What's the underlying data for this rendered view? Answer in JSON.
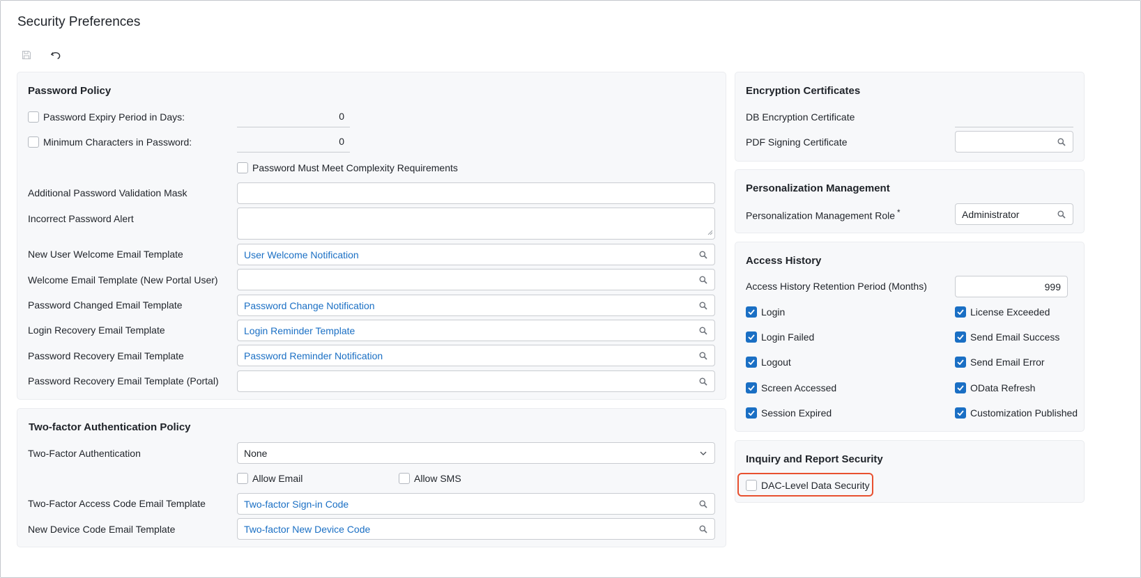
{
  "page": {
    "title": "Security Preferences"
  },
  "toolbar": {
    "save_icon": "save-icon",
    "undo_icon": "undo-icon"
  },
  "password_policy": {
    "title": "Password Policy",
    "expiry": {
      "label": "Password Expiry Period in Days:",
      "value": "0",
      "checked": false
    },
    "min_chars": {
      "label": "Minimum Characters in Password:",
      "value": "0",
      "checked": false
    },
    "complexity": {
      "label": "Password Must Meet Complexity Requirements",
      "checked": false
    },
    "validation_mask": {
      "label": "Additional Password Validation Mask",
      "value": ""
    },
    "incorrect_alert": {
      "label": "Incorrect Password Alert",
      "value": ""
    },
    "welcome_email": {
      "label": "New User Welcome Email Template",
      "value": "User Welcome Notification"
    },
    "portal_welcome_email": {
      "label": "Welcome Email Template (New Portal User)",
      "value": ""
    },
    "changed_email": {
      "label": "Password Changed Email Template",
      "value": "Password Change Notification"
    },
    "login_recovery_email": {
      "label": "Login Recovery Email Template",
      "value": "Login Reminder Template"
    },
    "recovery_email": {
      "label": "Password Recovery Email Template",
      "value": "Password Reminder Notification"
    },
    "recovery_email_portal": {
      "label": "Password Recovery Email Template (Portal)",
      "value": ""
    }
  },
  "two_factor": {
    "title": "Two-factor Authentication Policy",
    "mode": {
      "label": "Two-Factor Authentication",
      "value": "None"
    },
    "allow_email": {
      "label": "Allow Email",
      "checked": false
    },
    "allow_sms": {
      "label": "Allow SMS",
      "checked": false
    },
    "access_code_email": {
      "label": "Two-Factor Access Code Email Template",
      "value": "Two-factor Sign-in Code"
    },
    "new_device_email": {
      "label": "New Device Code Email Template",
      "value": "Two-factor New Device Code"
    }
  },
  "encryption": {
    "title": "Encryption Certificates",
    "db_cert": {
      "label": "DB Encryption Certificate",
      "value": ""
    },
    "pdf_cert": {
      "label": "PDF Signing Certificate",
      "value": ""
    }
  },
  "personalization": {
    "title": "Personalization Management",
    "role": {
      "label": "Personalization Management Role",
      "required_mark": "*",
      "value": "Administrator"
    }
  },
  "access_history": {
    "title": "Access History",
    "retention": {
      "label": "Access History Retention Period (Months)",
      "value": "999"
    },
    "left_items": [
      {
        "label": "Login",
        "checked": true
      },
      {
        "label": "Login Failed",
        "checked": true
      },
      {
        "label": "Logout",
        "checked": true
      },
      {
        "label": "Screen Accessed",
        "checked": true
      },
      {
        "label": "Session Expired",
        "checked": true
      }
    ],
    "right_items": [
      {
        "label": "License Exceeded",
        "checked": true
      },
      {
        "label": "Send Email Success",
        "checked": true
      },
      {
        "label": "Send Email Error",
        "checked": true
      },
      {
        "label": "OData Refresh",
        "checked": true
      },
      {
        "label": "Customization Published",
        "checked": true
      }
    ]
  },
  "inquiry": {
    "title": "Inquiry and Report Security",
    "dac": {
      "label": "DAC-Level Data Security",
      "checked": false
    },
    "highlight_color": "#e8502f"
  },
  "colors": {
    "accent": "#1a6fc4",
    "panel_bg": "#f7f8fa"
  }
}
